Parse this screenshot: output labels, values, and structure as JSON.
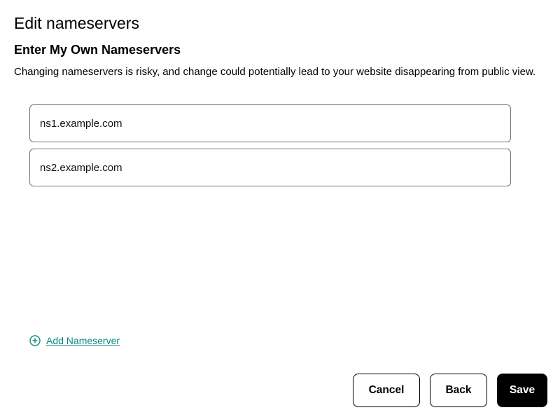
{
  "header": {
    "title": "Edit nameservers",
    "subtitle": "Enter My Own Nameservers",
    "warning": "Changing nameservers is risky, and change could potentially lead to your website disappearing from public view."
  },
  "nameservers": [
    {
      "value": "ns1.example.com"
    },
    {
      "value": "ns2.example.com"
    }
  ],
  "addLink": {
    "label": "Add Nameserver"
  },
  "actions": {
    "cancel": "Cancel",
    "back": "Back",
    "save": "Save"
  },
  "colors": {
    "accent_teal": "#0f8a7e",
    "primary_black": "#000000"
  }
}
